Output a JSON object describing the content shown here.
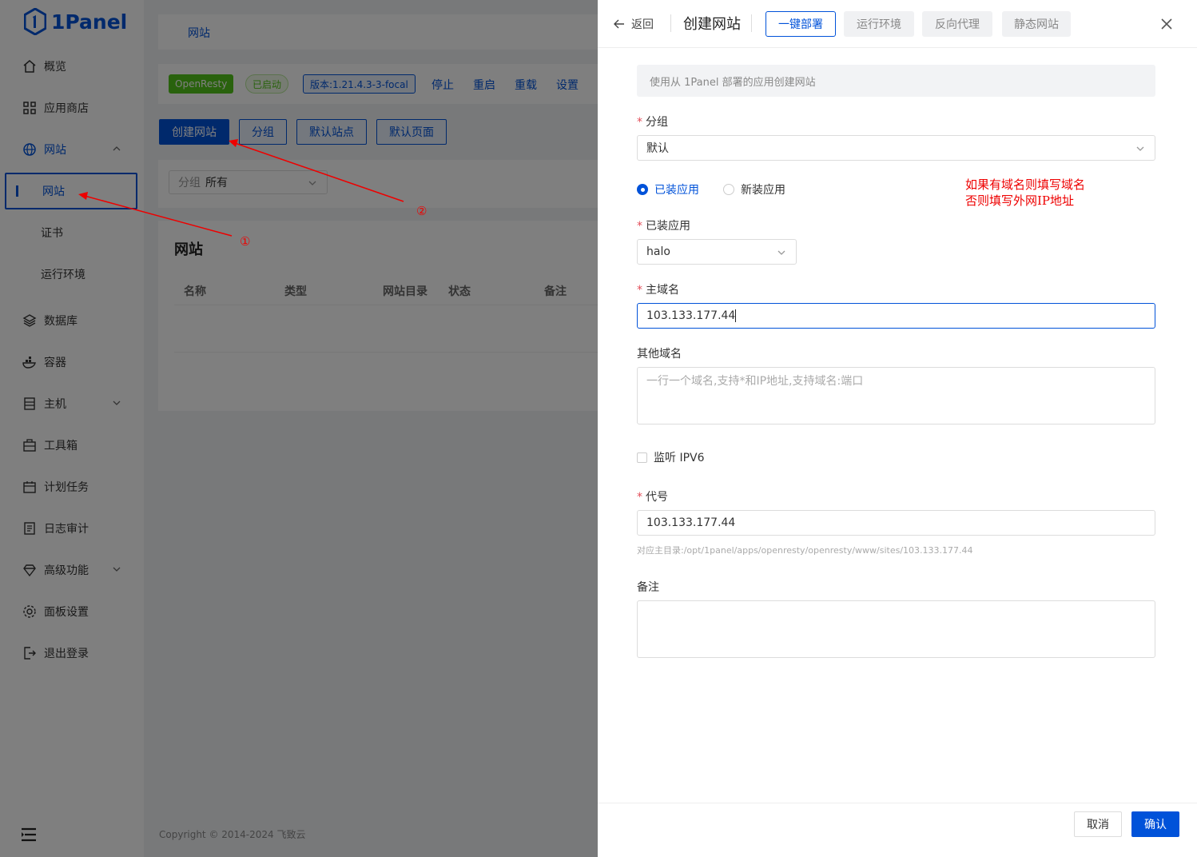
{
  "brand": {
    "name": "1Panel"
  },
  "sidebar": {
    "items": [
      {
        "label": "概览",
        "icon": "home-icon"
      },
      {
        "label": "应用商店",
        "icon": "grid-icon"
      },
      {
        "label": "网站",
        "icon": "globe-icon"
      },
      {
        "label": "网站"
      },
      {
        "label": "证书"
      },
      {
        "label": "运行环境"
      },
      {
        "label": "数据库",
        "icon": "layers-icon"
      },
      {
        "label": "容器",
        "icon": "docker-icon"
      },
      {
        "label": "主机",
        "icon": "server-icon"
      },
      {
        "label": "工具箱",
        "icon": "toolbox-icon"
      },
      {
        "label": "计划任务",
        "icon": "calendar-icon"
      },
      {
        "label": "日志审计",
        "icon": "log-icon"
      },
      {
        "label": "高级功能",
        "icon": "diamond-icon"
      },
      {
        "label": "面板设置",
        "icon": "gear-icon"
      },
      {
        "label": "退出登录",
        "icon": "logout-icon"
      }
    ]
  },
  "main": {
    "breadcrumb": "网站",
    "status": {
      "app": "OpenResty",
      "state": "已启动",
      "version": "版本:1.21.4.3-3-focal"
    },
    "actions": [
      "停止",
      "重启",
      "重载",
      "设置"
    ],
    "toolbar": [
      "创建网站",
      "分组",
      "默认站点",
      "默认页面"
    ],
    "filter": {
      "label": "分组",
      "value": "所有"
    },
    "title": "网站",
    "columns": [
      "名称",
      "类型",
      "网站目录",
      "状态",
      "备注"
    ],
    "footer": "Copyright © 2014-2024 飞致云"
  },
  "annotations": {
    "a1": "①",
    "a2": "②",
    "note_line1": "如果有域名则填写域名",
    "note_line2": "否则填写外网IP地址"
  },
  "drawer": {
    "back": "返回",
    "title": "创建网站",
    "tabs": [
      "一键部署",
      "运行环境",
      "反向代理",
      "静态网站"
    ],
    "info": "使用从 1Panel 部署的应用创建网站",
    "group_label": "分组",
    "group_value": "默认",
    "radio_installed": "已装应用",
    "radio_new": "新装应用",
    "installed_label": "已装应用",
    "installed_value": "halo",
    "domain_label": "主域名",
    "domain_value": "103.133.177.44",
    "other_label": "其他域名",
    "other_placeholder": "一行一个域名,支持*和IP地址,支持域名:端口",
    "ipv6_label": "监听 IPV6",
    "alias_label": "代号",
    "alias_value": "103.133.177.44",
    "alias_hint": "对应主目录:/opt/1panel/apps/openresty/openresty/www/sites/103.133.177.44",
    "remark_label": "备注",
    "cancel": "取消",
    "confirm": "确认"
  },
  "colors": {
    "accent": "#0052d9",
    "success": "#52c41a",
    "annotation": "#e00000"
  }
}
